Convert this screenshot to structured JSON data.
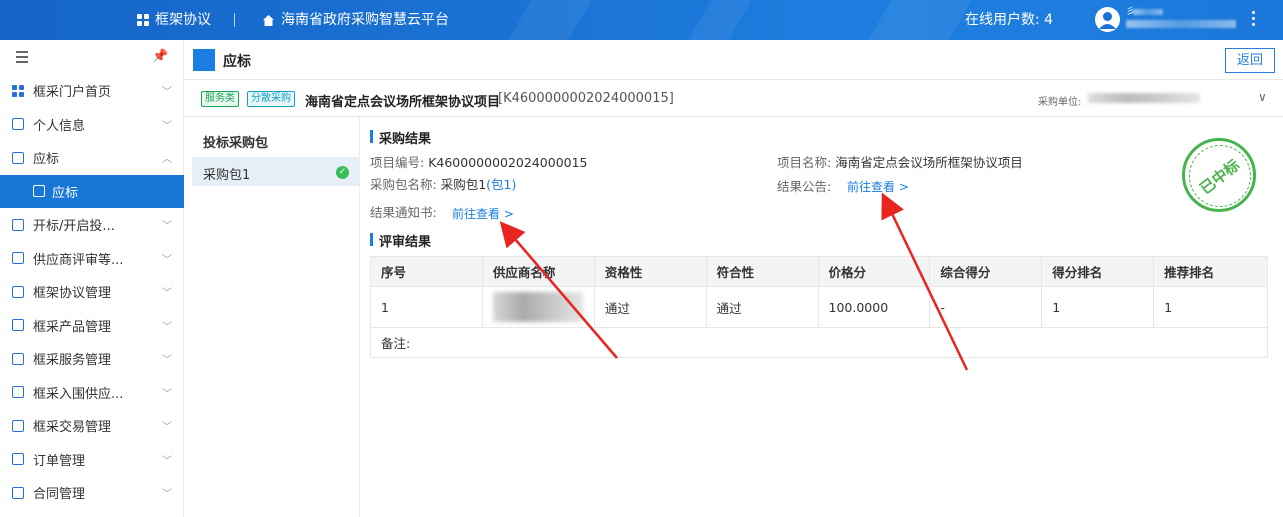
{
  "topbar": {
    "app_name": "框架协议",
    "platform_name": "海南省政府采购智慧云平台",
    "online_users_label": "在线用户数: 4",
    "user_initial": "彡"
  },
  "sidebar": {
    "items": [
      {
        "label": "框采门户首页",
        "icon": "grid-icon"
      },
      {
        "label": "个人信息",
        "icon": "profile-icon"
      },
      {
        "label": "应标",
        "icon": "bid-icon",
        "expanded": true
      },
      {
        "label": "应标",
        "icon": "bid-doc-icon",
        "active": true
      },
      {
        "label": "开标/开启投...",
        "icon": "opening-icon"
      },
      {
        "label": "供应商评审等...",
        "icon": "review-icon"
      },
      {
        "label": "框架协议管理",
        "icon": "agreement-icon"
      },
      {
        "label": "框采产品管理",
        "icon": "product-icon"
      },
      {
        "label": "框采服务管理",
        "icon": "service-icon"
      },
      {
        "label": "框采入围供应...",
        "icon": "shortlist-icon"
      },
      {
        "label": "框采交易管理",
        "icon": "trade-icon"
      },
      {
        "label": "订单管理",
        "icon": "order-icon"
      },
      {
        "label": "合同管理",
        "icon": "contract-icon"
      }
    ]
  },
  "page": {
    "title": "应标",
    "back_label": "返回"
  },
  "project": {
    "tag_service": "服务类",
    "tag_dispersed": "分散采购",
    "title": "海南省定点会议场所框架协议项目",
    "code": "[K4600000002024000015]",
    "buyer_label": "采购单位:"
  },
  "packages": {
    "header": "投标采购包",
    "items": [
      {
        "label": "采购包1",
        "status": "done"
      }
    ]
  },
  "result": {
    "section_title": "采购结果",
    "project_no_label": "项目编号:",
    "project_no": "K4600000002024000015",
    "project_name_label": "项目名称:",
    "project_name": "海南省定点会议场所框架协议项目",
    "package_name_label": "采购包名称:",
    "package_name": "采购包1",
    "package_link": "(包1)",
    "announcement_label": "结果公告:",
    "announcement_link": "前往查看 >",
    "notice_label": "结果通知书:",
    "notice_link": "前往查看 >",
    "stamp_text": "已中标"
  },
  "evaluation": {
    "section_title": "评审结果",
    "columns": [
      "序号",
      "供应商名称",
      "资格性",
      "符合性",
      "价格分",
      "综合得分",
      "得分排名",
      "推荐排名"
    ],
    "rows": [
      [
        "1",
        "",
        "通过",
        "通过",
        "100.0000",
        "-",
        "1",
        "1"
      ]
    ],
    "remark_label": "备注:"
  },
  "colors": {
    "primary": "#1a7ee3",
    "stamp": "#46b34b",
    "annotation": "#e8251e"
  }
}
